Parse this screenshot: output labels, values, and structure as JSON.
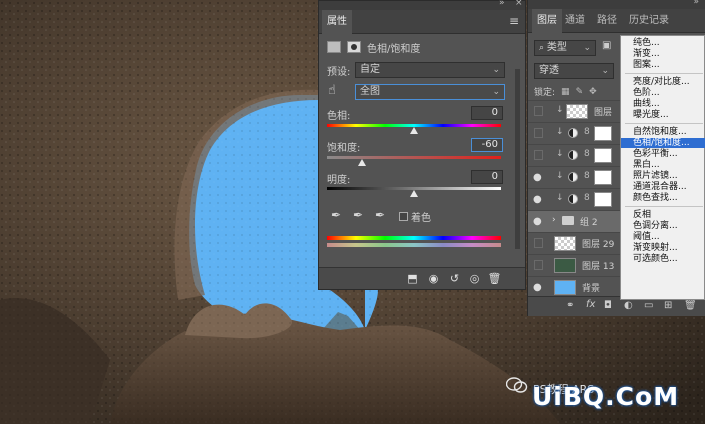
{
  "properties_panel": {
    "tab_label": "属性",
    "adjustment_title": "色相/饱和度",
    "preset_label": "预设:",
    "preset_value": "自定",
    "channel_value": "全图",
    "hue_label": "色相:",
    "hue_value": "0",
    "saturation_label": "饱和度:",
    "saturation_value": "-60",
    "lightness_label": "明度:",
    "lightness_value": "0",
    "colorize_label": "着色",
    "colorize_checked": false,
    "hue_fraction": 0.5,
    "saturation_fraction": 0.2,
    "lightness_fraction": 0.5
  },
  "layers_panel": {
    "tabs": [
      "图层",
      "通道",
      "路径",
      "历史记录"
    ],
    "active_tab": "图层",
    "filter_kind": "类型",
    "blend_mode": "穿透",
    "lock_label": "锁定:",
    "layers": [
      {
        "name": "图层",
        "visible": false
      },
      {
        "name": "",
        "visible": false
      },
      {
        "name": "",
        "visible": false
      },
      {
        "name": "",
        "visible": true
      },
      {
        "name": "",
        "visible": true
      },
      {
        "name": "组 2",
        "visible": true
      },
      {
        "name": "图层 29",
        "visible": false
      },
      {
        "name": "图层 13",
        "visible": false
      },
      {
        "name": "背景",
        "visible": true
      }
    ]
  },
  "adjustment_menu": {
    "items": [
      "纯色...",
      "渐变...",
      "图案...",
      "亮度/对比度...",
      "色阶...",
      "曲线...",
      "曝光度...",
      "自然饱和度...",
      "色相/饱和度...",
      "色彩平衡...",
      "黑白...",
      "照片滤镜...",
      "通道混合器...",
      "颜色查找...",
      "反相",
      "色调分离...",
      "阈值...",
      "渐变映射...",
      "可选颜色..."
    ],
    "highlighted": "色相/饱和度..."
  },
  "watermark": {
    "brand": "UiBQ.CoM",
    "sub": "PS教程 ARS"
  }
}
